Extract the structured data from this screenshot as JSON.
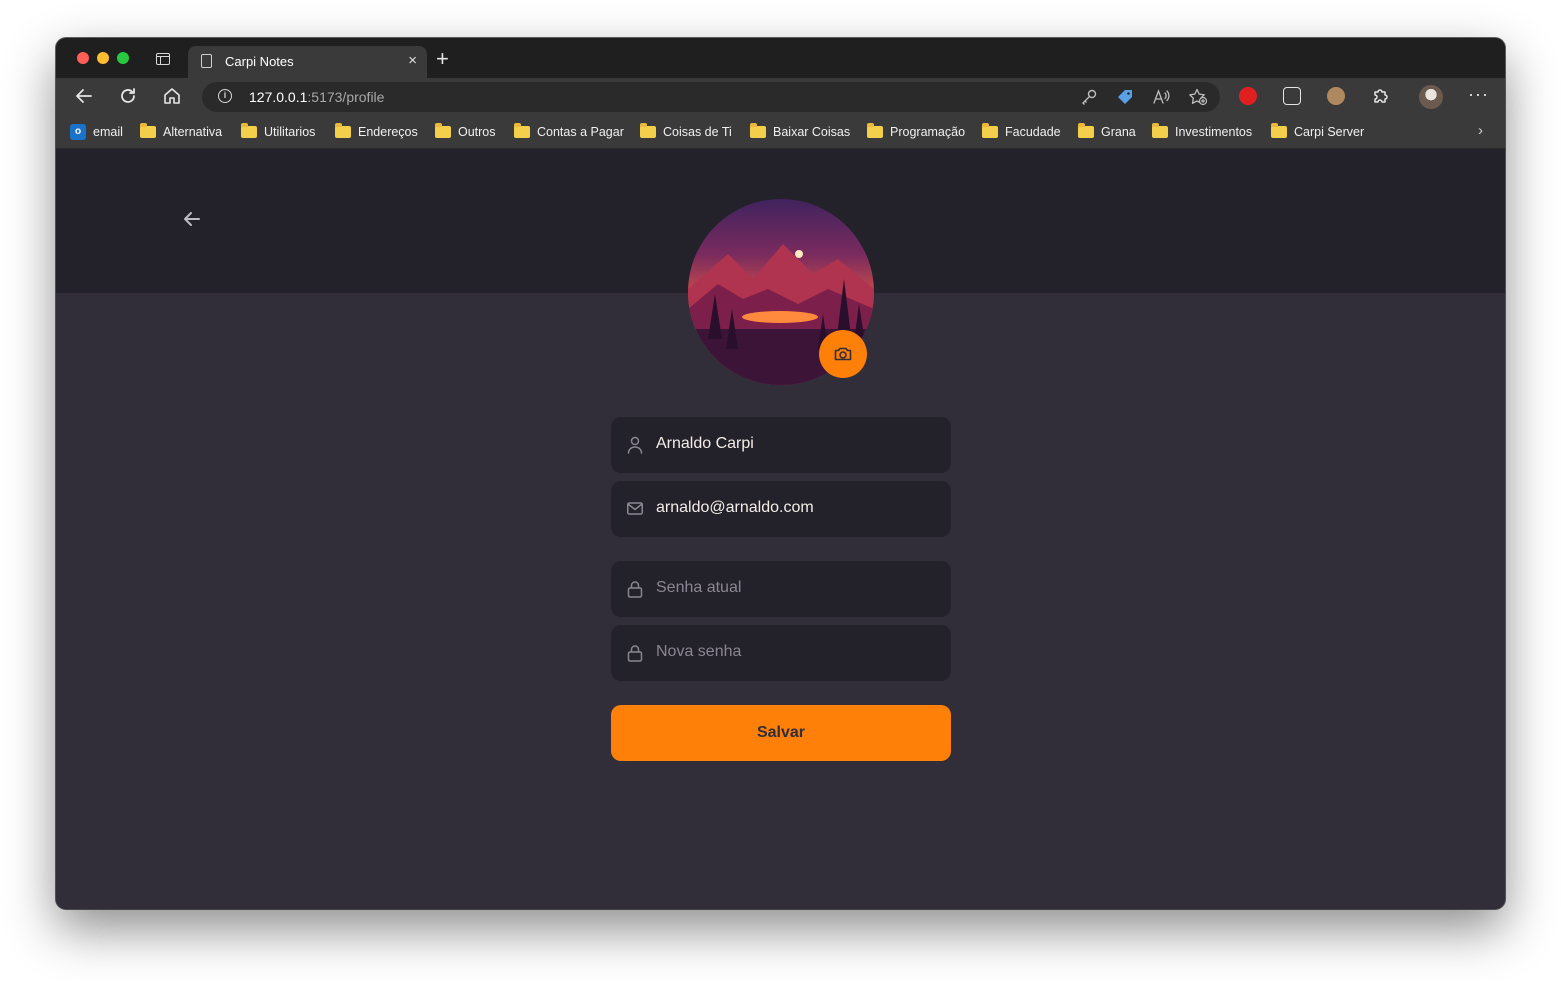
{
  "browser": {
    "tab_title": "Carpi Notes",
    "close_glyph": "×",
    "new_tab_glyph": "+",
    "url_host": "127.0.0.1",
    "url_path": ":5173/profile",
    "info_glyph": "i",
    "menu_glyph": "···",
    "more_glyph": "›"
  },
  "bookmarks": [
    {
      "label": "email",
      "icon": "outlook-icon"
    },
    {
      "label": "Alternativa",
      "icon": "folder-icon"
    },
    {
      "label": "Utilitarios",
      "icon": "folder-icon"
    },
    {
      "label": "Endereços",
      "icon": "folder-icon"
    },
    {
      "label": "Outros",
      "icon": "folder-icon"
    },
    {
      "label": "Contas a Pagar",
      "icon": "folder-icon"
    },
    {
      "label": "Coisas de Ti",
      "icon": "folder-icon"
    },
    {
      "label": "Baixar Coisas",
      "icon": "folder-icon"
    },
    {
      "label": "Programação",
      "icon": "folder-icon"
    },
    {
      "label": "Facudade",
      "icon": "folder-icon"
    },
    {
      "label": "Grana",
      "icon": "folder-icon"
    },
    {
      "label": "Investimentos",
      "icon": "folder-icon"
    },
    {
      "label": "Carpi Server",
      "icon": "folder-icon"
    }
  ],
  "profile": {
    "name_value": "Arnaldo Carpi",
    "email_value": "arnaldo@arnaldo.com",
    "current_password_placeholder": "Senha atual",
    "new_password_placeholder": "Nova senha",
    "save_label": "Salvar"
  },
  "colors": {
    "accent": "#ff8008",
    "background": "#312d39",
    "header": "#232129",
    "input_bg": "#232129",
    "text": "#f4ede8",
    "placeholder": "#8a8694"
  }
}
